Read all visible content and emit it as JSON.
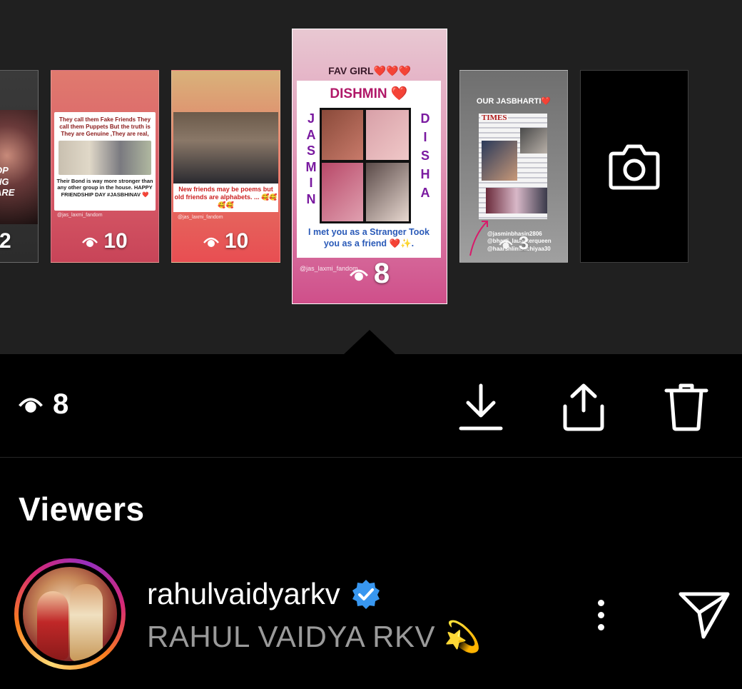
{
  "thumbnails": [
    {
      "id": "partial",
      "count": "2",
      "snippet": [
        "OP",
        "NG",
        "ARE"
      ]
    },
    {
      "id": "friendship-day",
      "count": "10",
      "caption_top": "They call them Fake Friends They call them Puppets But the truth is They are Genuine ,They are real,",
      "caption_bottom": "Their Bond is way more stronger than any other group in the house. HAPPY FRIENDSHIP DAY #JASBHINAV ❤️",
      "handle": "@jas_laxmi_fandom"
    },
    {
      "id": "friends-poems",
      "count": "10",
      "caption": "New friends may be poems but old friends are alphabets. ... 🥰🥰🥰🥰",
      "handle": "@jas_laxmi_fandom"
    },
    {
      "id": "fav-girl",
      "count": "8",
      "banner": "FAV GIRL❤️❤️❤️",
      "title": "DISHMIN ❤️",
      "left_name": [
        "J",
        "A",
        "S",
        "M",
        "I",
        "N"
      ],
      "right_name": [
        "D",
        "I",
        "S",
        "H",
        "A"
      ],
      "caption": "I met you as a Stranger Took you as a friend ❤️✨.",
      "handle": "@jas_laxmi_fandom"
    },
    {
      "id": "our-jasbharti",
      "count": "3",
      "banner": "OUR JASBHARTI❤️",
      "masthead": "TIMES",
      "handles": [
        "@jasminbhasin2806",
        "@bharti_laughterqueen",
        "@haarshlimbachiyaa30"
      ]
    },
    {
      "id": "camera",
      "icon": "camera-icon"
    }
  ],
  "selected": {
    "view_count": "8"
  },
  "actions": {
    "download": "download-icon",
    "share": "share-icon",
    "delete": "trash-icon"
  },
  "viewers": {
    "heading": "Viewers",
    "items": [
      {
        "username": "rahulvaidyarkv",
        "verified": true,
        "full_name": "RAHUL VAIDYA RKV 💫"
      }
    ]
  },
  "colors": {
    "verified": "#3897f0",
    "secondary_text": "#9a9a9a",
    "tray_bg": "#202020"
  }
}
